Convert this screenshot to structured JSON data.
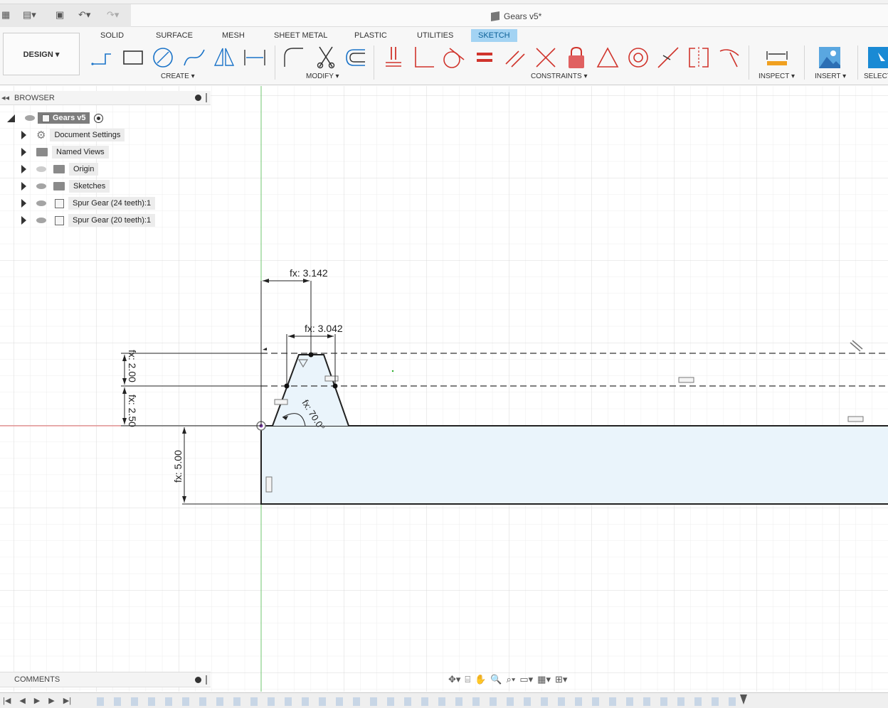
{
  "window": {
    "title": "Gears v5*"
  },
  "toolbar": {
    "tabs": [
      "SOLID",
      "SURFACE",
      "MESH",
      "SHEET METAL",
      "PLASTIC",
      "UTILITIES",
      "SKETCH"
    ],
    "active_tab": "SKETCH",
    "workspace_button": "DESIGN ▾",
    "groups": {
      "create": "CREATE ▾",
      "modify": "MODIFY ▾",
      "constraints": "CONSTRAINTS ▾",
      "inspect": "INSPECT ▾",
      "insert": "INSERT ▾",
      "select": "SELECT"
    }
  },
  "browser": {
    "title": "BROWSER",
    "root": "Gears v5",
    "items": [
      {
        "label": "Document Settings",
        "icon": "gear-icon"
      },
      {
        "label": "Named Views",
        "icon": "folder-icon"
      },
      {
        "label": "Origin",
        "icon": "folder-icon"
      },
      {
        "label": "Sketches",
        "icon": "folder-icon"
      },
      {
        "label": "Spur Gear (24 teeth):1",
        "icon": "component-icon"
      },
      {
        "label": "Spur Gear (20 teeth):1",
        "icon": "component-icon"
      }
    ]
  },
  "comments": {
    "title": "COMMENTS"
  },
  "sketch": {
    "dimensions": {
      "width_top": "fx: 3.142",
      "width_mid": "fx: 3.042",
      "height_a": "fx: 2.00",
      "height_b": "fx: 2.50",
      "height_c": "fx: 5.00",
      "angle": "fx: 70.0°"
    }
  },
  "colors": {
    "accent": "#0696d7",
    "active_tab_bg": "#a3d3f3",
    "profile_fill": "#eaf4fb",
    "x_axis": "#e46a6a",
    "y_axis": "#6fc46f"
  }
}
